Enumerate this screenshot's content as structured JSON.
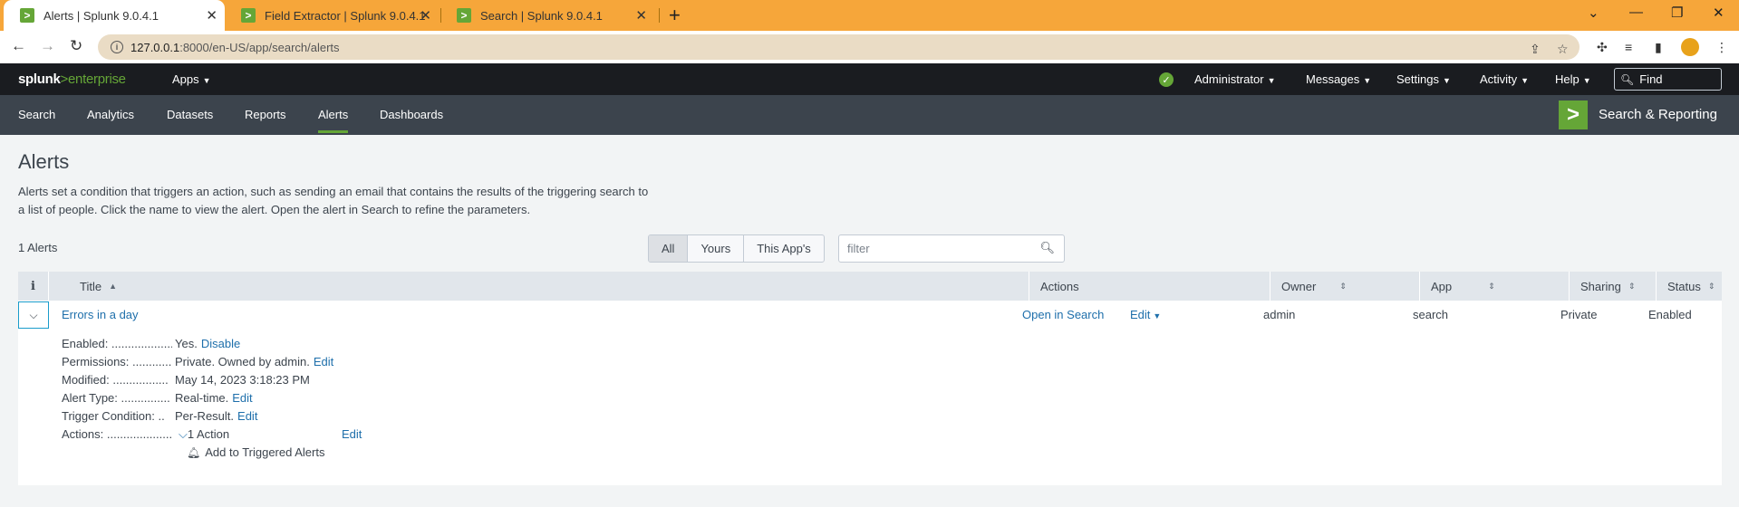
{
  "browser": {
    "tabs": [
      {
        "title": "Alerts | Splunk 9.0.4.1",
        "active": true
      },
      {
        "title": "Field Extractor | Splunk 9.0.4.1",
        "active": false
      },
      {
        "title": "Search | Splunk 9.0.4.1",
        "active": false
      }
    ],
    "url_host": "127.0.0.1",
    "url_path": ":8000/en-US/app/search/alerts"
  },
  "splunk_header": {
    "logo_brand": "splunk",
    "logo_gt": ">",
    "logo_product": "enterprise",
    "apps_menu": "Apps",
    "user_menu": "Administrator",
    "messages_menu": "Messages",
    "settings_menu": "Settings",
    "activity_menu": "Activity",
    "help_menu": "Help",
    "find_placeholder": "Find"
  },
  "app_bar": {
    "nav": [
      "Search",
      "Analytics",
      "Datasets",
      "Reports",
      "Alerts",
      "Dashboards"
    ],
    "active_nav": "Alerts",
    "app_badge": ">",
    "app_title": "Search & Reporting"
  },
  "page": {
    "title": "Alerts",
    "description": "Alerts set a condition that triggers an action, such as sending an email that contains the results of the triggering search to a list of people. Click the name to view the alert. Open the alert in Search to refine the parameters.",
    "count": "1 Alerts",
    "scope_tabs": [
      "All",
      "Yours",
      "This App's"
    ],
    "selected_scope": "All",
    "filter_placeholder": "filter"
  },
  "table": {
    "headers": {
      "info": "i",
      "title": "Title",
      "actions": "Actions",
      "owner": "Owner",
      "app": "App",
      "sharing": "Sharing",
      "status": "Status"
    },
    "row": {
      "title": "Errors in a day",
      "open_in_search": "Open in Search",
      "edit": "Edit",
      "owner": "admin",
      "app": "search",
      "sharing": "Private",
      "status": "Enabled"
    },
    "details": {
      "enabled_label": "Enabled: ...................",
      "enabled_value": "Yes.",
      "enabled_action": "Disable",
      "permissions_label": "Permissions: ............",
      "permissions_value": "Private. Owned by admin.",
      "permissions_action": "Edit",
      "modified_label": "Modified: .................",
      "modified_value": "May 14, 2023 3:18:23 PM",
      "alert_type_label": "Alert Type: ...............",
      "alert_type_value": "Real-time.",
      "alert_type_action": "Edit",
      "trigger_label": "Trigger Condition: ..",
      "trigger_value": "Per-Result.",
      "trigger_action": "Edit",
      "actions_label": "Actions: ....................",
      "actions_value": "1 Action",
      "actions_action": "Edit",
      "triggered_action": "Add to Triggered Alerts"
    }
  },
  "colors": {
    "accent_green": "#65a637",
    "link_blue": "#1e6fab",
    "chrome_orange": "#f6a63a"
  }
}
